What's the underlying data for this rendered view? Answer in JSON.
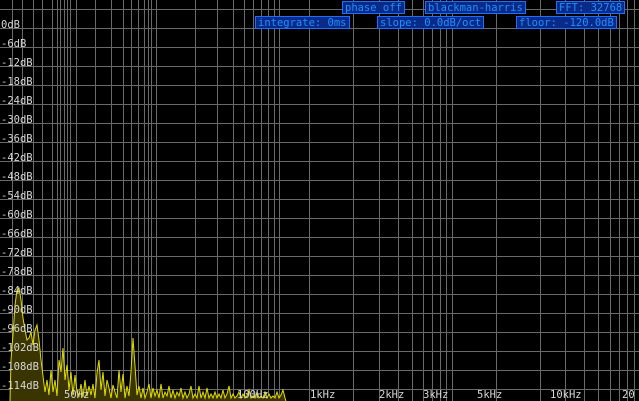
{
  "controls": {
    "phase": "phase off",
    "window": "blackman-harris",
    "fft": "FFT: 32768",
    "integrate": "integrate: 0ms",
    "slope": "slope: 0.0dB/oct",
    "floor": "floor: -120.0dB"
  },
  "db_labels": [
    "0dB",
    "-6dB",
    "-12dB",
    "-18dB",
    "-24dB",
    "-30dB",
    "-36dB",
    "-42dB",
    "-48dB",
    "-54dB",
    "-60dB",
    "-66dB",
    "-72dB",
    "-78dB",
    "-84dB",
    "-90dB",
    "-96dB",
    "-102dB",
    "-108dB",
    "-114dB"
  ],
  "freq_labels": [
    "50Hz",
    "100Hz",
    "1kHz",
    "2kHz",
    "3kHz",
    "5kHz",
    "10kHz",
    "20"
  ],
  "colors": {
    "spectrum": "#e0dc00",
    "spectrum_fill": "#3a3400",
    "grid": "#6a6a6a",
    "badge_bg": "#0a2a8a",
    "badge_text": "#1e90ff"
  }
}
